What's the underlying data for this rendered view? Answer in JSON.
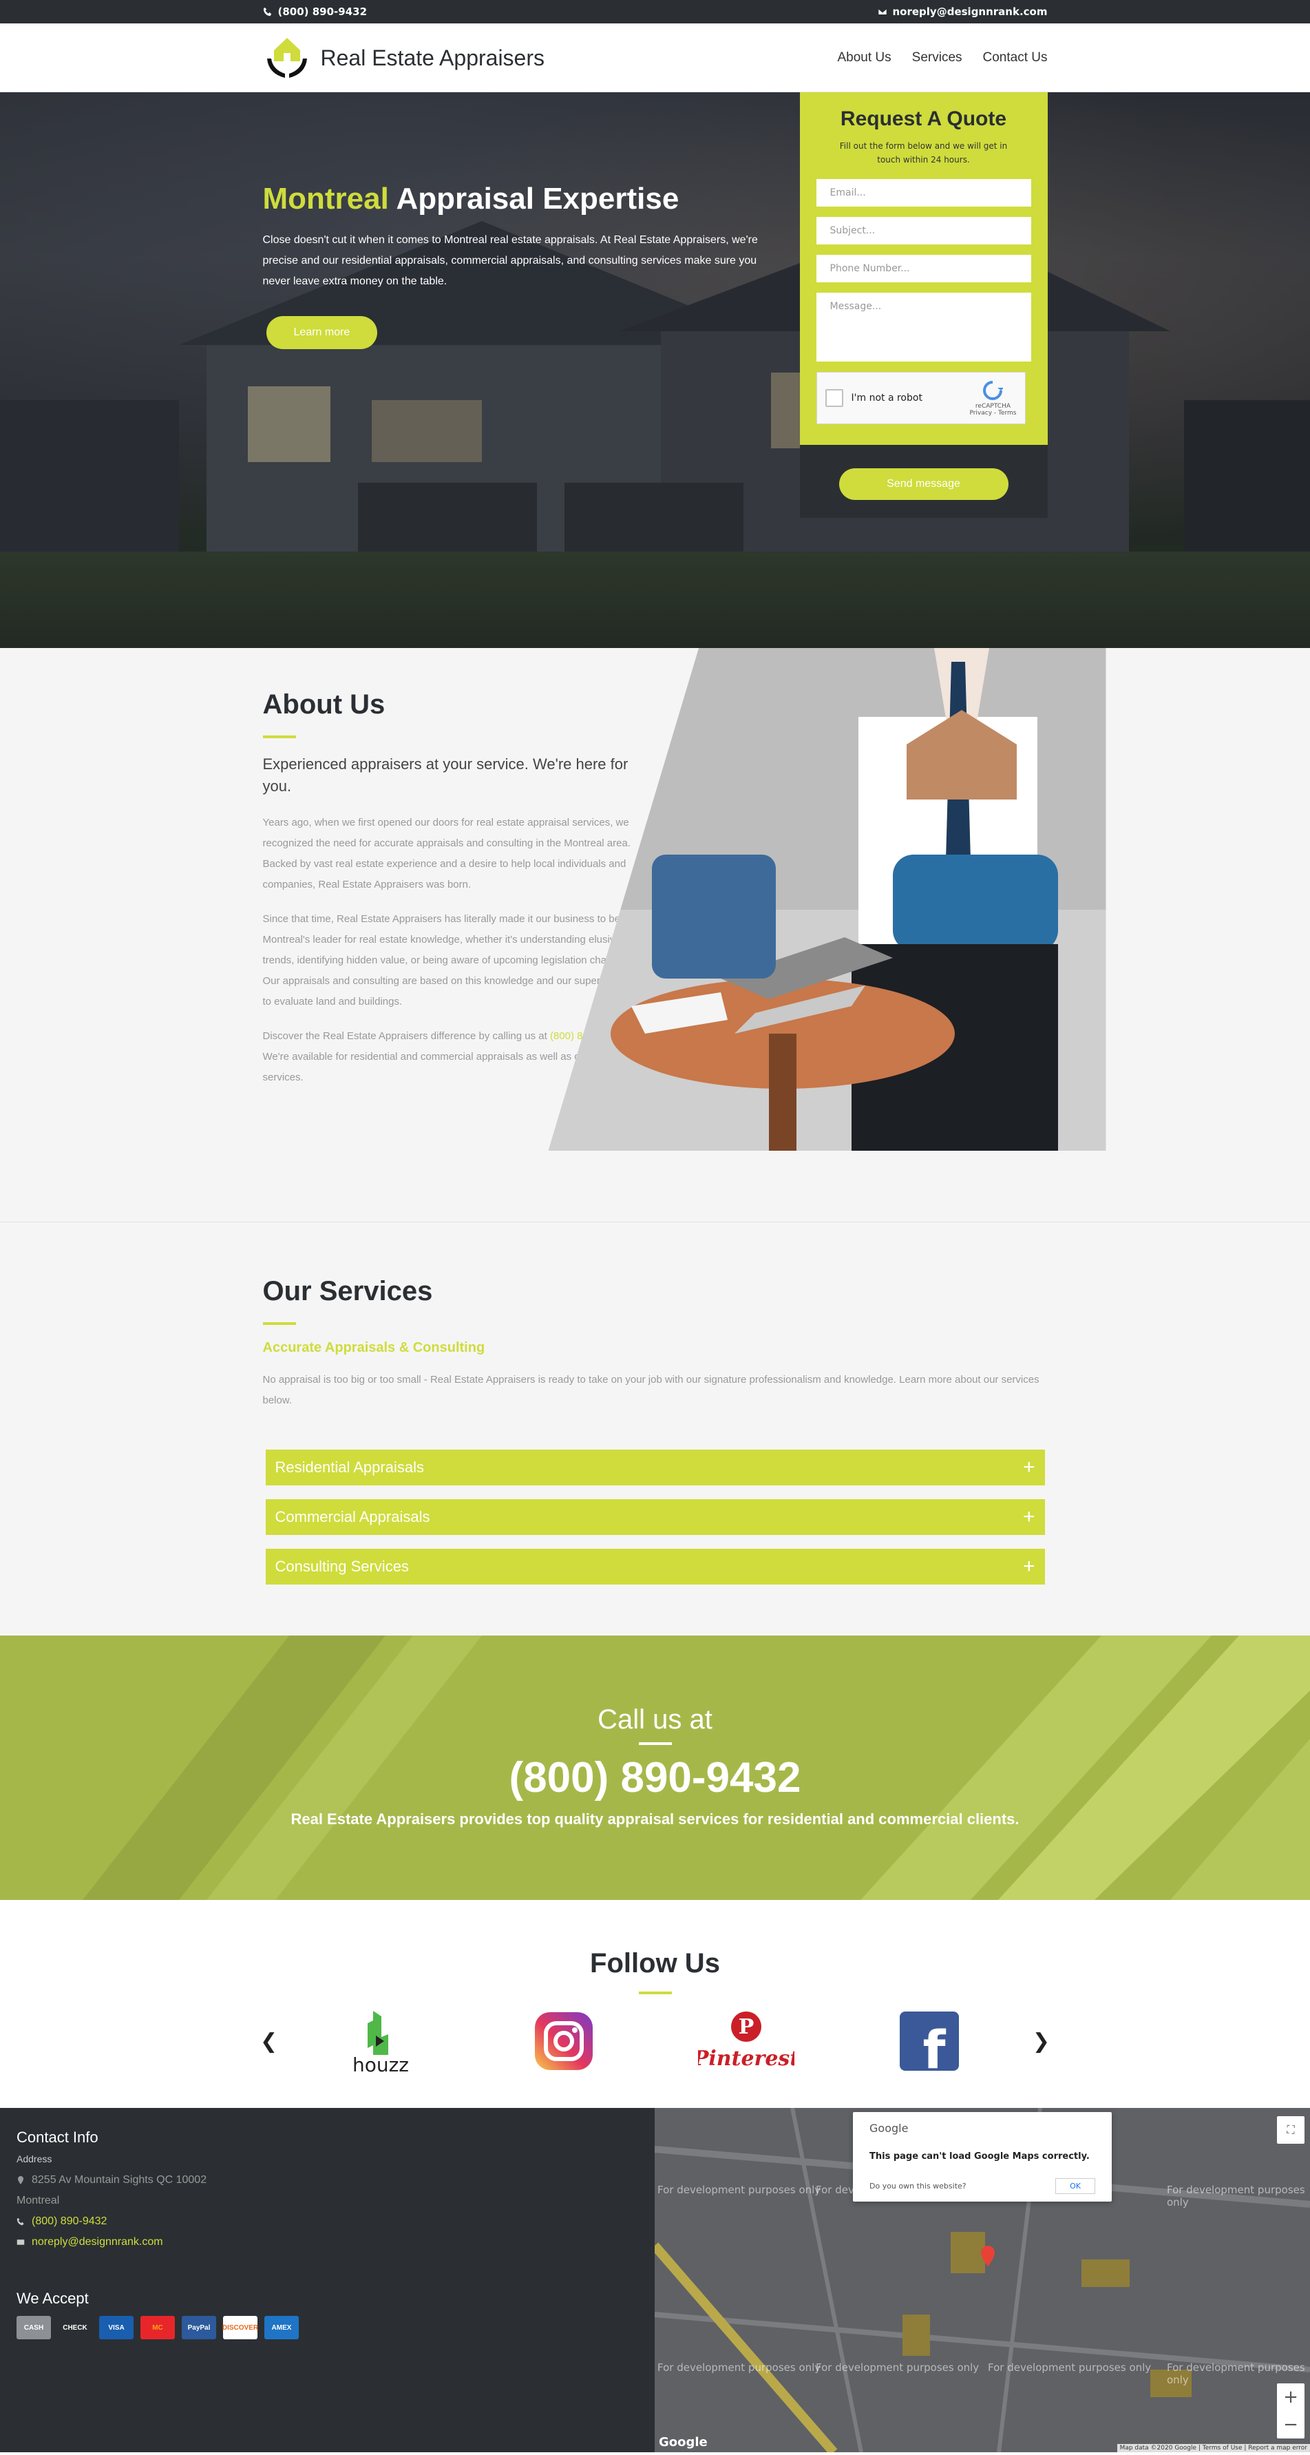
{
  "topbar": {
    "phone": "(800) 890-9432",
    "email": "noreply@designnrank.com"
  },
  "header": {
    "brand": "Real Estate Appraisers",
    "nav": [
      {
        "label": "About Us"
      },
      {
        "label": "Services"
      },
      {
        "label": "Contact Us"
      }
    ]
  },
  "hero": {
    "title_highlight": "Montreal",
    "title_rest": " Appraisal Expertise",
    "description": "Close doesn't cut it when it comes to Montreal real estate appraisals. At Real Estate Appraisers, we're precise and our residential appraisals, commercial appraisals, and consulting services make sure you never leave extra money on the table.",
    "button": "Learn more"
  },
  "quote": {
    "title": "Request A Quote",
    "subtitle": "Fill out the form below and we will get in touch within 24 hours.",
    "email_placeholder": "Email...",
    "subject_placeholder": "Subject...",
    "phone_placeholder": "Phone Number...",
    "message_placeholder": "Message...",
    "captcha_label": "I'm not a robot",
    "captcha_brand": "reCAPTCHA",
    "captcha_links": "Privacy - Terms",
    "submit": "Send message"
  },
  "about": {
    "title": "About Us",
    "subtitle": "Experienced appraisers at your service. We're here for you.",
    "p1": "Years ago, when we first opened our doors for real estate appraisal services, we recognized the need for accurate appraisals and consulting in the Montreal area. Backed by vast real estate experience and a desire to help local individuals and companies, Real Estate Appraisers was born.",
    "p2": "Since that time, Real Estate Appraisers has literally made it our business to be Montreal's leader for real estate knowledge, whether it's understanding elusive trends, identifying hidden value, or being aware of upcoming legislation changes. Our appraisals and consulting are based on this knowledge and our superior ability to evaluate land and buildings.",
    "p3_before": "Discover the Real Estate Appraisers difference by calling us at ",
    "p3_phone": "(800) 890-9432",
    "p3_after": ". We're available for residential and commercial appraisals as well as consulting services."
  },
  "services": {
    "title": "Our Services",
    "tagline": "Accurate Appraisals & Consulting",
    "description": "No appraisal is too big or too small - Real Estate Appraisers is ready to take on your job with our signature professionalism and knowledge. Learn more about our services below.",
    "items": [
      {
        "label": "Residential Appraisals"
      },
      {
        "label": "Commercial Appraisals"
      },
      {
        "label": "Consulting Services"
      }
    ]
  },
  "call": {
    "pre": "Call us at",
    "phone": "(800) 890-9432",
    "description": "Real Estate Appraisers provides top quality appraisal services for residential and commercial clients."
  },
  "follow": {
    "title": "Follow Us",
    "networks": [
      {
        "name": "houzz",
        "label": "houzz"
      },
      {
        "name": "instagram",
        "label": ""
      },
      {
        "name": "pinterest",
        "label": "Pinterest"
      },
      {
        "name": "facebook",
        "label": "f"
      }
    ]
  },
  "footer": {
    "contact_title": "Contact Info",
    "address_label": "Address",
    "address_line1": "8255 Av Mountain Sights QC 10002",
    "address_line2": "Montreal",
    "phone": "(800) 890-9432",
    "email": "noreply@designnrank.com",
    "accept_title": "We Accept",
    "cards": [
      {
        "label": "CASH",
        "bg": "#8d9094",
        "fg": "#fff"
      },
      {
        "label": "CHECK",
        "bg": "#2b2f33",
        "fg": "#fff"
      },
      {
        "label": "VISA",
        "bg": "#1a5eb0",
        "fg": "#fff"
      },
      {
        "label": "MC",
        "bg": "#e8262a",
        "fg": "#f7a21b"
      },
      {
        "label": "PayPal",
        "bg": "#2c5a9c",
        "fg": "#fff"
      },
      {
        "label": "DISCOVER",
        "bg": "#ffffff",
        "fg": "#e66a1b"
      },
      {
        "label": "AMEX",
        "bg": "#1f74c6",
        "fg": "#fff"
      }
    ]
  },
  "map": {
    "dialog_brand": "Google",
    "dialog_message": "This page can't load Google Maps correctly.",
    "dialog_question": "Do you own this website?",
    "dialog_ok": "OK",
    "watermark": "For development purposes only",
    "logo": "Google",
    "attribution": "Map data ©2020 Google | Terms of Use | Report a map error"
  },
  "colors": {
    "accent": "#cfdc3c",
    "dark": "#2b2f33",
    "light_bg": "#f5f5f5"
  }
}
